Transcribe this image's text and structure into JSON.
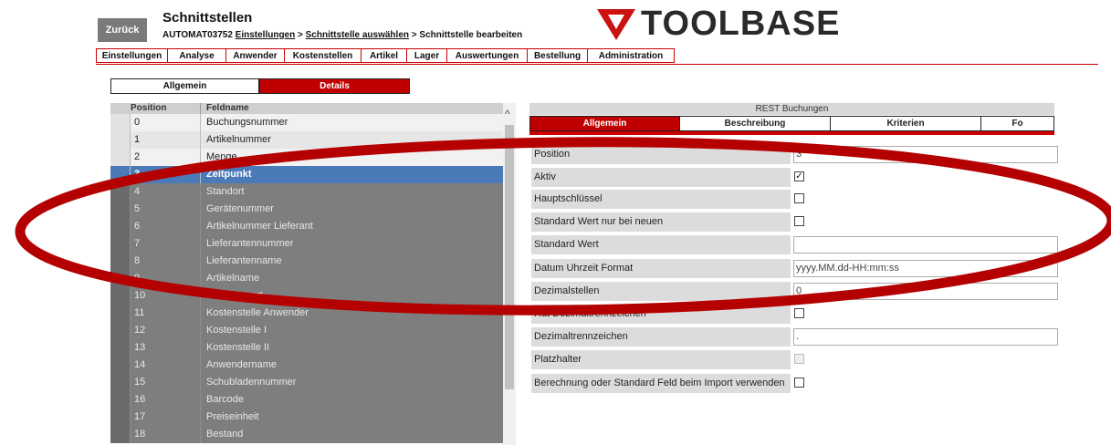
{
  "header": {
    "back_label": "Zurück",
    "title": "Schnittstellen",
    "breadcrumb": {
      "user": "AUTOMAT03752",
      "link1": "Einstellungen",
      "sep1": ">",
      "link2": "Schnittstelle auswählen",
      "sep2": ">",
      "current": "Schnittstelle bearbeiten"
    },
    "logo_text": "TOOLBASE"
  },
  "nav": {
    "items": [
      "Einstellungen",
      "Analyse",
      "Anwender",
      "Kostenstellen",
      "Artikel",
      "Lager",
      "Auswertungen",
      "Bestellung",
      "Administration"
    ]
  },
  "subtabs": {
    "items": [
      "Allgemein",
      "Details"
    ],
    "active": "Details"
  },
  "list": {
    "headers": {
      "position": "Position",
      "name": "Feldname"
    },
    "rows": [
      {
        "pos": "0",
        "name": "Buchungsnummer"
      },
      {
        "pos": "1",
        "name": "Artikelnummer"
      },
      {
        "pos": "2",
        "name": "Menge"
      },
      {
        "pos": "3",
        "name": "Zeitpunkt"
      },
      {
        "pos": "4",
        "name": "Standort"
      },
      {
        "pos": "5",
        "name": "Gerätenummer"
      },
      {
        "pos": "6",
        "name": "Artikelnummer Lieferant"
      },
      {
        "pos": "7",
        "name": "Lieferantennummer"
      },
      {
        "pos": "8",
        "name": "Lieferantenname"
      },
      {
        "pos": "9",
        "name": "Artikelname"
      },
      {
        "pos": "10",
        "name": "Buchungsart"
      },
      {
        "pos": "11",
        "name": "Kostenstelle Anwender"
      },
      {
        "pos": "12",
        "name": "Kostenstelle I"
      },
      {
        "pos": "13",
        "name": "Kostenstelle II"
      },
      {
        "pos": "14",
        "name": "Anwendername"
      },
      {
        "pos": "15",
        "name": "Schubladennummer"
      },
      {
        "pos": "16",
        "name": "Barcode"
      },
      {
        "pos": "17",
        "name": "Preiseinheit"
      },
      {
        "pos": "18",
        "name": "Bestand"
      }
    ],
    "selected_index": 3
  },
  "panel": {
    "title": "REST Buchungen",
    "tabs": [
      "Allgemein",
      "Beschreibung",
      "Kriterien",
      "Fo"
    ],
    "active_tab": "Allgemein",
    "fields": [
      {
        "label": "Position",
        "type": "text",
        "value": "3"
      },
      {
        "label": "Aktiv",
        "type": "checkbox",
        "checked": true
      },
      {
        "label": "Hauptschlüssel",
        "type": "checkbox",
        "checked": false
      },
      {
        "label": "Standard Wert nur bei neuen",
        "type": "checkbox",
        "checked": false
      },
      {
        "label": "Standard Wert",
        "type": "text",
        "value": ""
      },
      {
        "label": "Datum Uhrzeit Format",
        "type": "text",
        "value": "yyyy.MM.dd-HH:mm:ss"
      },
      {
        "label": "Dezimalstellen",
        "type": "text",
        "value": "0"
      },
      {
        "label": "Hat Dezimaltrennzeichen",
        "type": "checkbox",
        "checked": false
      },
      {
        "label": "Dezimaltrennzeichen",
        "type": "text",
        "value": "."
      },
      {
        "label": "Platzhalter",
        "type": "checkbox",
        "checked": false,
        "disabled": true
      },
      {
        "label": "Berechnung oder Standard Feld beim Import verwenden",
        "type": "checkbox",
        "checked": false
      }
    ]
  },
  "colors": {
    "accent_red": "#c00000",
    "selected_blue": "#4a7ab8",
    "annotation_red": "#b40000"
  }
}
